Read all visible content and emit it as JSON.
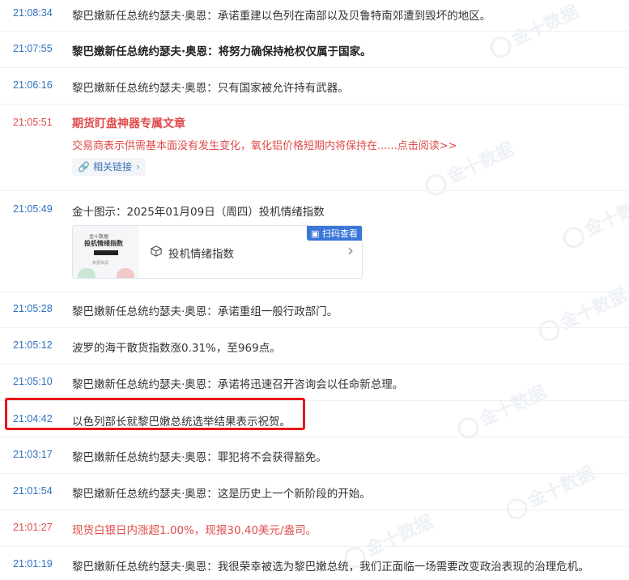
{
  "watermark": "金十数据",
  "feed": [
    {
      "time": "21:08:34",
      "text": "黎巴嫩新任总统约瑟夫·奥恩：承诺重建以色列在南部以及贝鲁特南郊遭到毁坏的地区。"
    },
    {
      "time": "21:07:55",
      "text": "黎巴嫩新任总统约瑟夫·奥恩：将努力确保持枪权仅属于国家。",
      "bold": true
    },
    {
      "time": "21:06:16",
      "text": "黎巴嫩新任总统约瑟夫·奥恩：只有国家被允许持有武器。"
    },
    {
      "time": "21:05:51",
      "title": "期货盯盘神器专属文章",
      "summary": "交易商表示供需基本面没有发生变化，氧化铝价格短期内将保持在......点击阅读>>",
      "link_label": "相关链接"
    },
    {
      "time": "21:05:49",
      "text": "金十图示：2025年01月09日（周四）投机情绪指数",
      "card": {
        "label": "投机情绪指数",
        "badge": "扫码查看",
        "thumb_line1": "金十数据",
        "thumb_line2": "投机情绪指数",
        "thumb_line3": "数据来源"
      }
    },
    {
      "time": "21:05:28",
      "text": "黎巴嫩新任总统约瑟夫·奥恩：承诺重组一般行政部门。"
    },
    {
      "time": "21:05:12",
      "text": "波罗的海干散货指数涨0.31%，至969点。"
    },
    {
      "time": "21:05:10",
      "text": "黎巴嫩新任总统约瑟夫·奥恩：承诺将迅速召开咨询会以任命新总理。"
    },
    {
      "time": "21:04:42",
      "text": "以色列部长就黎巴嫩总统选举结果表示祝贺。"
    },
    {
      "time": "21:03:17",
      "text": "黎巴嫩新任总统约瑟夫·奥恩：罪犯将不会获得豁免。"
    },
    {
      "time": "21:01:54",
      "text": "黎巴嫩新任总统约瑟夫·奥恩：这是历史上一个新阶段的开始。"
    },
    {
      "time": "21:01:27",
      "text": "现货白银日内涨超1.00%，现报30.40美元/盎司。",
      "red": true
    },
    {
      "time": "21:01:19",
      "text": "黎巴嫩新任总统约瑟夫·奥恩：我很荣幸被选为黎巴嫩总统，我们正面临一场需要改变政治表现的治理危机。"
    }
  ],
  "colors": {
    "time": "#2f70c0",
    "red": "#e04b4b",
    "highlight": "#e8161b"
  }
}
